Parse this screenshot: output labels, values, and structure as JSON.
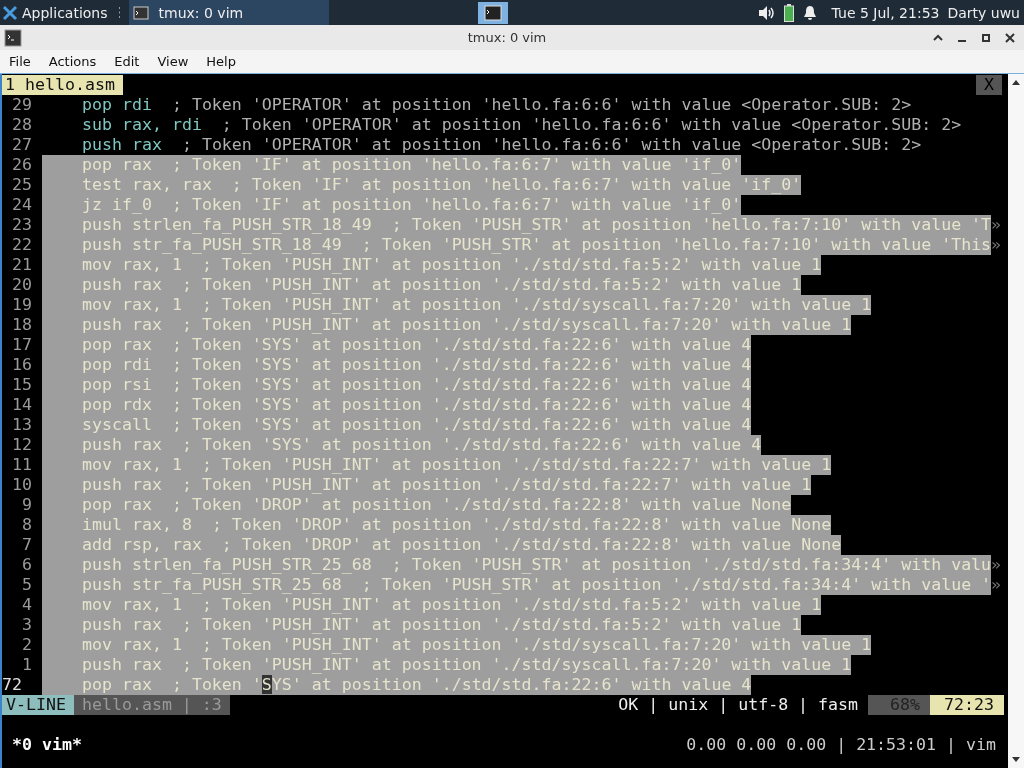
{
  "taskbar": {
    "menu_label": "Applications",
    "window_buttons": [
      {
        "label": "tmux: 0 vim",
        "selected": true
      }
    ],
    "clock": "Tue  5 Jul, 21:53",
    "user": "Darty uwu"
  },
  "window": {
    "title": "tmux: 0 vim"
  },
  "menu": [
    "File",
    "Actions",
    "Edit",
    "View",
    "Help"
  ],
  "vim": {
    "buffer_tab": "1 hello.asm",
    "close_label": "X",
    "lines": [
      {
        "number": "29",
        "code": "pop rdi",
        "comment": "; Token 'OPERATOR' at position 'hello.fa:6:6' with value <Operator.SUB: 2>",
        "selected": false,
        "current": false
      },
      {
        "number": "28",
        "code": "sub rax, rdi",
        "comment": "; Token 'OPERATOR' at position 'hello.fa:6:6' with value <Operator.SUB: 2>",
        "selected": false,
        "current": false
      },
      {
        "number": "27",
        "code": "push rax",
        "comment": "; Token 'OPERATOR' at position 'hello.fa:6:6' with value <Operator.SUB: 2>",
        "selected": false,
        "current": false
      },
      {
        "number": "26",
        "code": "pop rax",
        "comment": "; Token 'IF' at position 'hello.fa:6:7' with value 'if_0'",
        "selected": true,
        "current": false
      },
      {
        "number": "25",
        "code": "test rax, rax",
        "comment": "; Token 'IF' at position 'hello.fa:6:7' with value 'if_0'",
        "selected": true,
        "current": false
      },
      {
        "number": "24",
        "code": "jz if_0",
        "comment": "; Token 'IF' at position 'hello.fa:6:7' with value 'if_0'",
        "selected": true,
        "current": false
      },
      {
        "number": "23",
        "code": "push strlen_fa_PUSH_STR_18_49",
        "comment": "; Token 'PUSH_STR' at position 'hello.fa:7:10' with value 'T",
        "selected": true,
        "current": false,
        "overflow": "»"
      },
      {
        "number": "22",
        "code": "push str_fa_PUSH_STR_18_49",
        "comment": "; Token 'PUSH_STR' at position 'hello.fa:7:10' with value 'This",
        "selected": true,
        "current": false,
        "overflow": "»"
      },
      {
        "number": "21",
        "code": "mov rax, 1",
        "comment": "; Token 'PUSH_INT' at position './std/std.fa:5:2' with value 1",
        "selected": true,
        "current": false
      },
      {
        "number": "20",
        "code": "push rax",
        "comment": "; Token 'PUSH_INT' at position './std/std.fa:5:2' with value 1",
        "selected": true,
        "current": false
      },
      {
        "number": "19",
        "code": "mov rax, 1",
        "comment": "; Token 'PUSH_INT' at position './std/syscall.fa:7:20' with value 1",
        "selected": true,
        "current": false
      },
      {
        "number": "18",
        "code": "push rax",
        "comment": "; Token 'PUSH_INT' at position './std/syscall.fa:7:20' with value 1",
        "selected": true,
        "current": false
      },
      {
        "number": "17",
        "code": "pop rax",
        "comment": "; Token 'SYS' at position './std/std.fa:22:6' with value 4",
        "selected": true,
        "current": false
      },
      {
        "number": "16",
        "code": "pop rdi",
        "comment": "; Token 'SYS' at position './std/std.fa:22:6' with value 4",
        "selected": true,
        "current": false
      },
      {
        "number": "15",
        "code": "pop rsi",
        "comment": "; Token 'SYS' at position './std/std.fa:22:6' with value 4",
        "selected": true,
        "current": false
      },
      {
        "number": "14",
        "code": "pop rdx",
        "comment": "; Token 'SYS' at position './std/std.fa:22:6' with value 4",
        "selected": true,
        "current": false
      },
      {
        "number": "13",
        "code": "syscall",
        "comment": "; Token 'SYS' at position './std/std.fa:22:6' with value 4",
        "selected": true,
        "current": false
      },
      {
        "number": "12",
        "code": "push rax",
        "comment": "; Token 'SYS' at position './std/std.fa:22:6' with value 4",
        "selected": true,
        "current": false
      },
      {
        "number": "11",
        "code": "mov rax, 1",
        "comment": "; Token 'PUSH_INT' at position './std/std.fa:22:7' with value 1",
        "selected": true,
        "current": false
      },
      {
        "number": "10",
        "code": "push rax",
        "comment": "; Token 'PUSH_INT' at position './std/std.fa:22:7' with value 1",
        "selected": true,
        "current": false
      },
      {
        "number": "9",
        "code": "pop rax",
        "comment": "; Token 'DROP' at position './std/std.fa:22:8' with value None",
        "selected": true,
        "current": false
      },
      {
        "number": "8",
        "code": "imul rax, 8",
        "comment": "; Token 'DROP' at position './std/std.fa:22:8' with value None",
        "selected": true,
        "current": false
      },
      {
        "number": "7",
        "code": "add rsp, rax",
        "comment": "; Token 'DROP' at position './std/std.fa:22:8' with value None",
        "selected": true,
        "current": false
      },
      {
        "number": "6",
        "code": "push strlen_fa_PUSH_STR_25_68",
        "comment": "; Token 'PUSH_STR' at position './std/std.fa:34:4' with valu",
        "selected": true,
        "current": false,
        "overflow": "»"
      },
      {
        "number": "5",
        "code": "push str_fa_PUSH_STR_25_68",
        "comment": "; Token 'PUSH_STR' at position './std/std.fa:34:4' with value '",
        "selected": true,
        "current": false,
        "overflow": "»"
      },
      {
        "number": "4",
        "code": "mov rax, 1",
        "comment": "; Token 'PUSH_INT' at position './std/std.fa:5:2' with value 1",
        "selected": true,
        "current": false
      },
      {
        "number": "3",
        "code": "push rax",
        "comment": "; Token 'PUSH_INT' at position './std/std.fa:5:2' with value 1",
        "selected": true,
        "current": false
      },
      {
        "number": "2",
        "code": "mov rax, 1",
        "comment": "; Token 'PUSH_INT' at position './std/syscall.fa:7:20' with value 1",
        "selected": true,
        "current": false
      },
      {
        "number": "1",
        "code": "push rax",
        "comment": "; Token 'PUSH_INT' at position './std/syscall.fa:7:20' with value 1",
        "selected": true,
        "current": false
      },
      {
        "number": "72",
        "code": "pop rax",
        "comment": "; Token '",
        "cursor": "S",
        "after_cursor": "YS' at position './std/std.fa:22:6' with value 4",
        "selected": true,
        "current": true
      }
    ],
    "status": {
      "mode": "V-LINE",
      "file": "hello.asm | :3",
      "info": "OK | unix | utf-8 | fasm",
      "percent": "68%",
      "position": "72:23"
    }
  },
  "tmux": {
    "window": "*0 vim*",
    "right": "0.00 0.00 0.00 | 21:53:01 | vim"
  }
}
